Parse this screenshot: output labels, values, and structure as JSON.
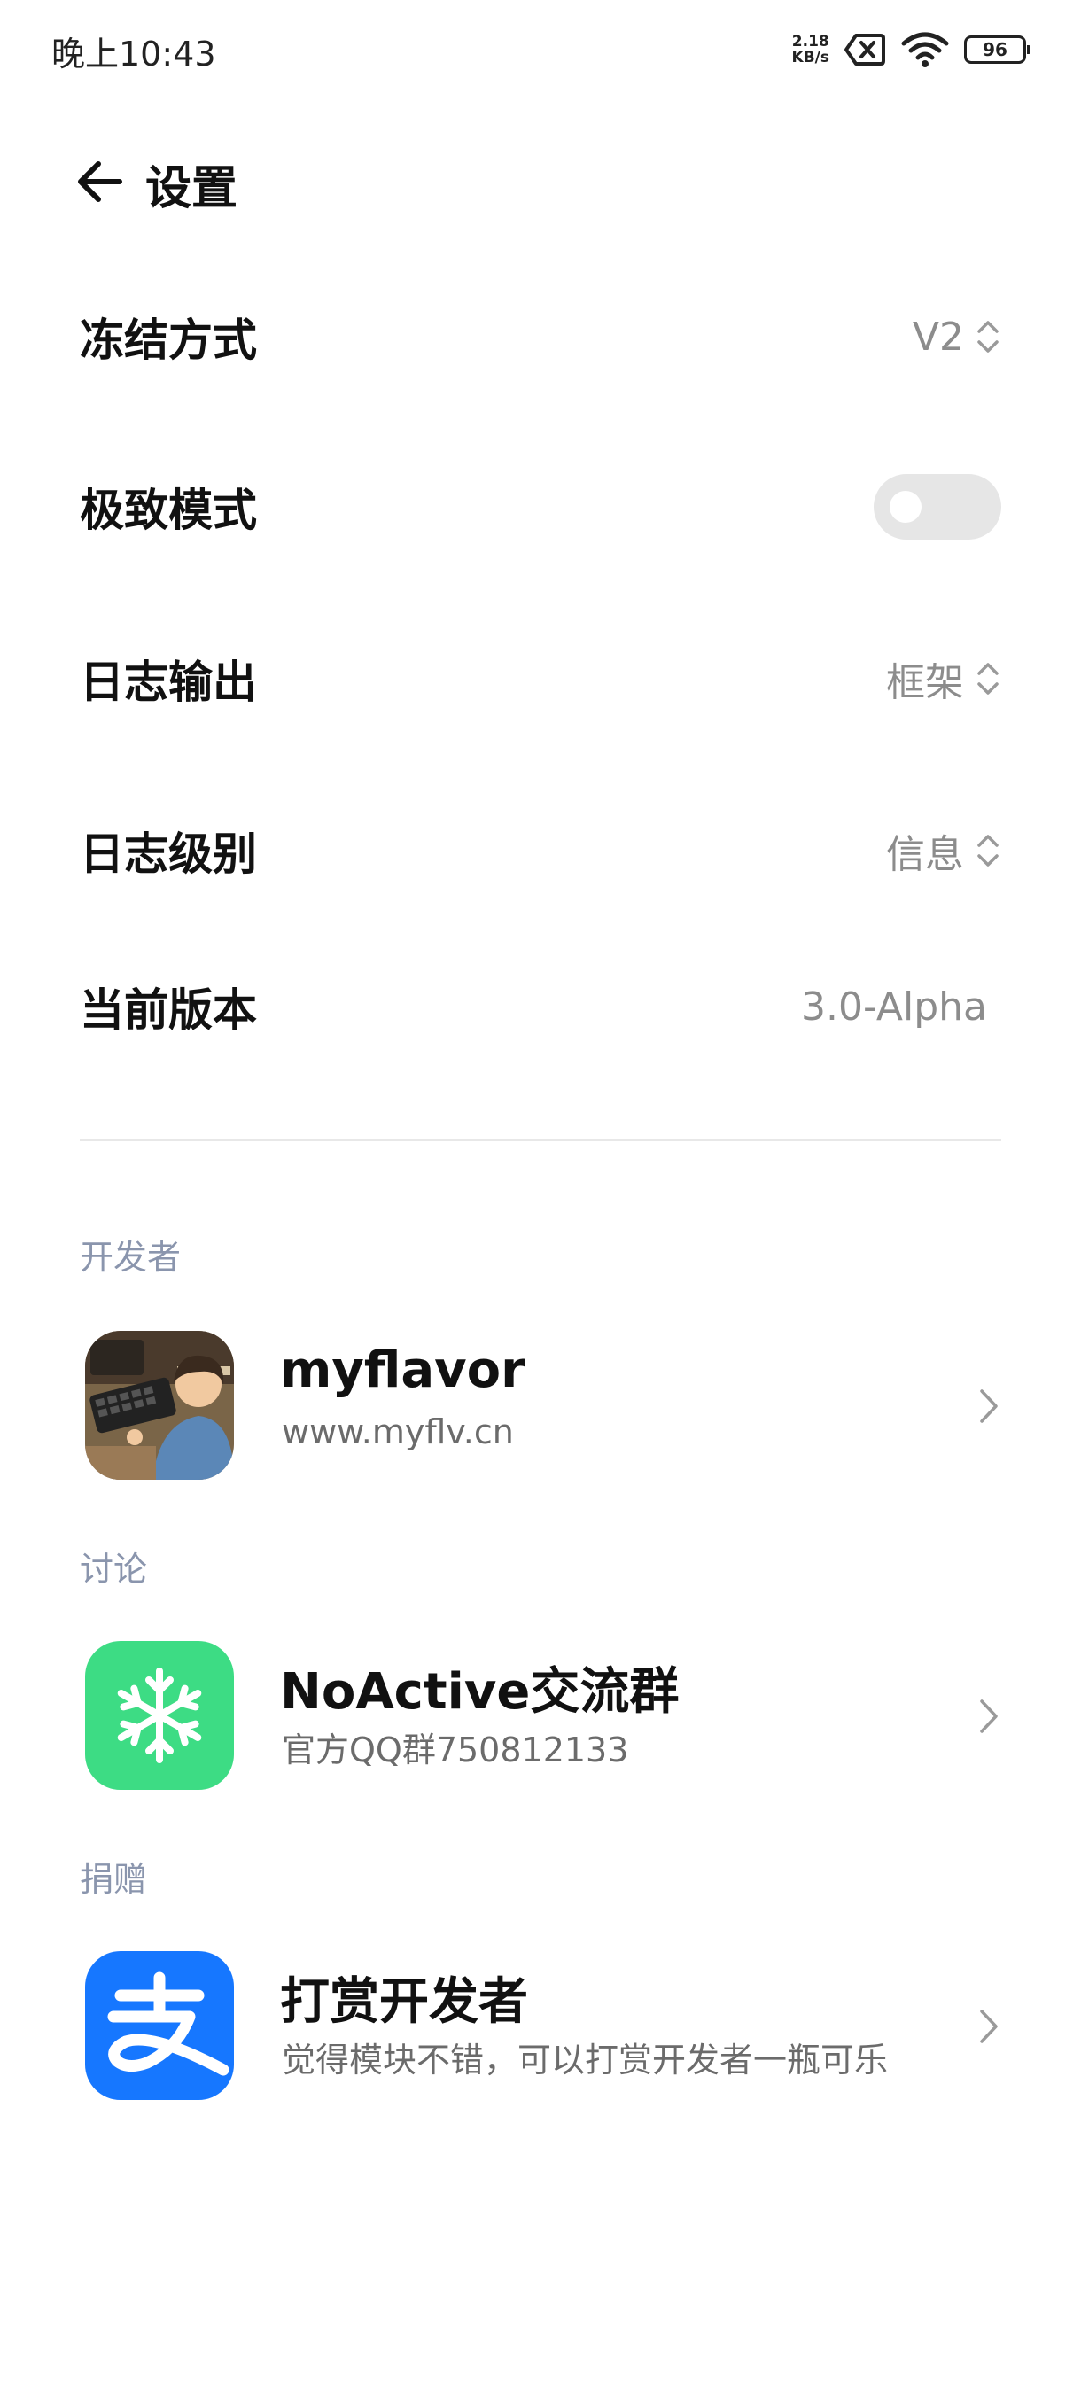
{
  "status_bar": {
    "time": "晚上10:43",
    "net_speed_value": "2.18",
    "net_speed_unit": "KB/s",
    "battery": "96",
    "icons": [
      "sim-error-icon",
      "wifi-icon",
      "battery-icon"
    ]
  },
  "header": {
    "title": "设置",
    "back_icon": "arrow-left-icon"
  },
  "settings": {
    "freeze_mode": {
      "label": "冻结方式",
      "value": "V2"
    },
    "extreme_mode": {
      "label": "极致模式",
      "enabled": false
    },
    "log_output": {
      "label": "日志输出",
      "value": "框架"
    },
    "log_level": {
      "label": "日志级别",
      "value": "信息"
    },
    "current_version": {
      "label": "当前版本",
      "value": "3.0-Alpha"
    }
  },
  "sections": {
    "developer": {
      "title": "开发者",
      "item": {
        "title": "myflavor",
        "subtitle": "www.myflv.cn"
      }
    },
    "discussion": {
      "title": "讨论",
      "item": {
        "title": "NoActive交流群",
        "subtitle": "官方QQ群750812133"
      }
    },
    "donate": {
      "title": "捐赠",
      "item": {
        "title": "打赏开发者",
        "subtitle": "觉得模块不错，可以打赏开发者一瓶可乐"
      }
    }
  },
  "colors": {
    "section_title": "#8a95ad",
    "value_gray": "#8c8c8c",
    "toggle_off_track": "#e6e6e6",
    "noactive_green": "#3ddc84",
    "alipay_blue": "#1677ff"
  }
}
